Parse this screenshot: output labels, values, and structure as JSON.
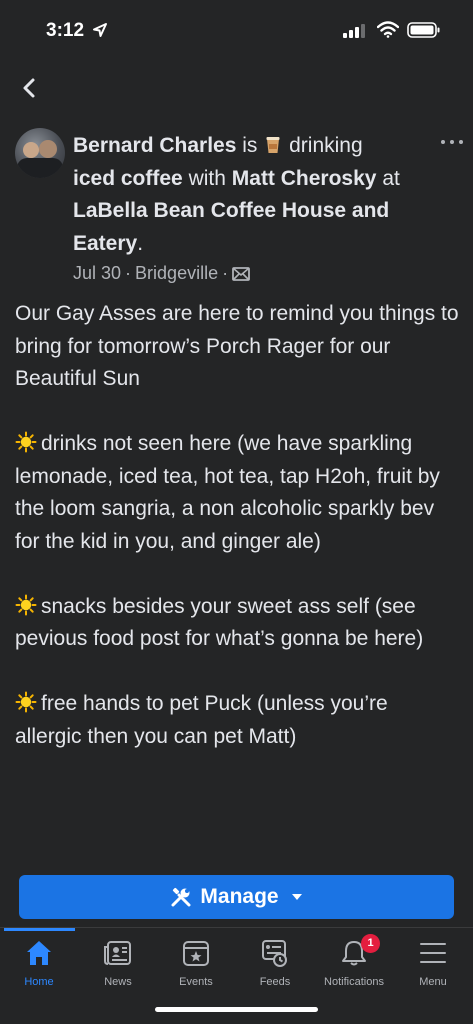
{
  "status_bar": {
    "time": "3:12"
  },
  "post": {
    "author": "Bernard Charles",
    "is_text": "is",
    "activity": "drinking",
    "item": "iced coffee",
    "with_text": "with",
    "tagged": "Matt Cherosky",
    "at_text": "at",
    "place": "LaBella Bean Coffee House and Eatery",
    "period": ".",
    "date": "Jul 30",
    "location": "Bridgeville",
    "separator": "·",
    "body": [
      "Our Gay Asses are here to remind you things to bring for tomorrow’s Porch Rager for our Beautiful Sun",
      "drinks not seen here (we have sparkling lemonade, iced tea, hot tea, tap H2oh, fruit by the loom sangria, a non alcoholic sparkly bev for the kid in you, and ginger ale)",
      "snacks besides your sweet ass self (see pevious food post for what’s gonna be here)",
      "free hands to pet Puck (unless you’re allergic then you can pet Matt)"
    ]
  },
  "manage_button": {
    "label": "Manage"
  },
  "tabs": [
    {
      "label": "Home",
      "icon": "home-icon",
      "active": true
    },
    {
      "label": "News",
      "icon": "news-icon"
    },
    {
      "label": "Events",
      "icon": "events-icon"
    },
    {
      "label": "Feeds",
      "icon": "feeds-icon"
    },
    {
      "label": "Notifications",
      "icon": "bell-icon",
      "badge": "1"
    },
    {
      "label": "Menu",
      "icon": "hamburger-icon"
    }
  ],
  "colors": {
    "background": "#242526",
    "accent": "#1b74e4",
    "tab_active": "#2d88ff",
    "badge": "#e41e3f"
  }
}
